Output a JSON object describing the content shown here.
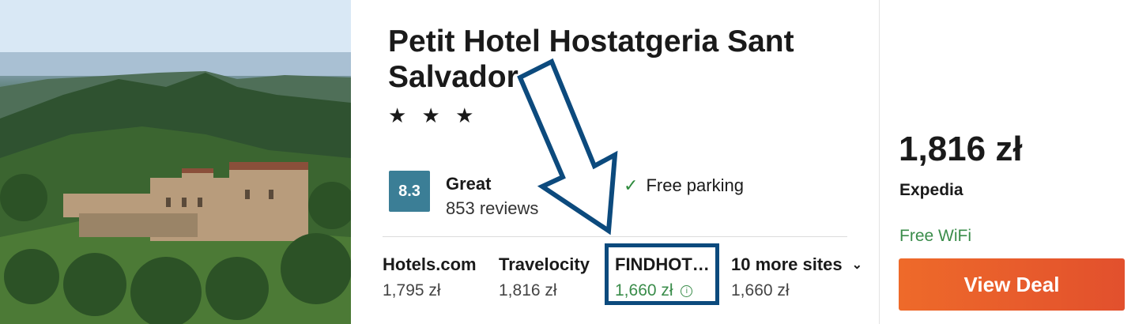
{
  "hotel": {
    "name": "Petit Hotel Hostatgeria Sant Salvador",
    "stars": "★ ★ ★",
    "score": "8.3",
    "rating_word": "Great",
    "reviews": "853 reviews",
    "amenity": "Free parking",
    "image": "hotel-photo"
  },
  "sites": [
    {
      "name": "Hotels.com",
      "price": "1,795 zł"
    },
    {
      "name": "Travelocity",
      "price": "1,816 zł"
    },
    {
      "name": "FINDHOT…",
      "price": "1,660 zł"
    }
  ],
  "more_sites": {
    "name": "10 more sites",
    "price": "1,660 zł"
  },
  "deal": {
    "price": "1,816 zł",
    "provider": "Expedia",
    "amenity": "Free WiFi",
    "button": "View Deal"
  },
  "colors": {
    "score_bg": "#3b7e96",
    "green": "#3a8c4a",
    "button": "#e85d2b",
    "annotation": "#0c4a7d"
  }
}
